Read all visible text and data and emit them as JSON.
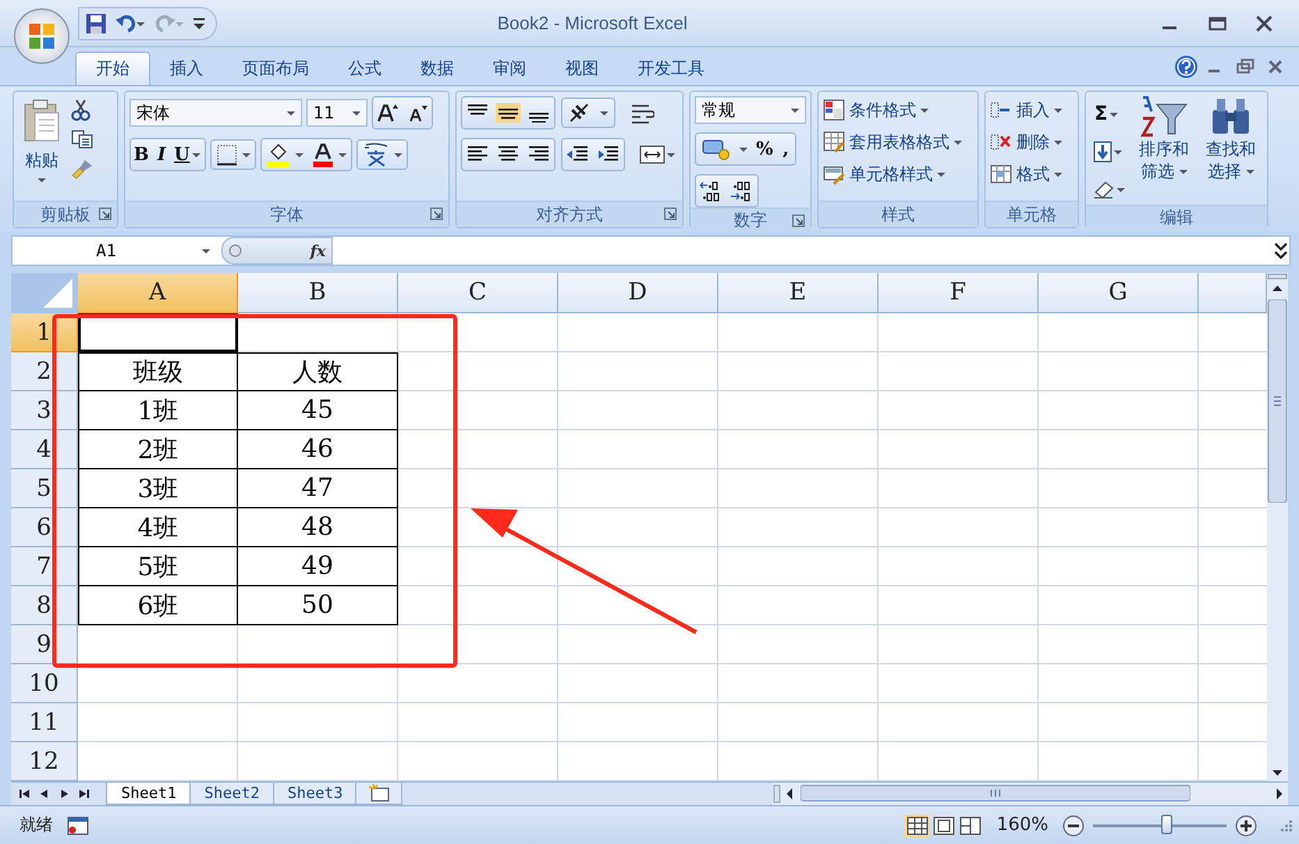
{
  "window": {
    "title": "Book2 - Microsoft Excel"
  },
  "tabs": [
    {
      "label": "开始",
      "selected": true
    },
    {
      "label": "插入",
      "selected": false
    },
    {
      "label": "页面布局",
      "selected": false
    },
    {
      "label": "公式",
      "selected": false
    },
    {
      "label": "数据",
      "selected": false
    },
    {
      "label": "审阅",
      "selected": false
    },
    {
      "label": "视图",
      "selected": false
    },
    {
      "label": "开发工具",
      "selected": false
    }
  ],
  "ribbon": {
    "clipboard": {
      "label": "剪贴板",
      "paste": "粘贴"
    },
    "font": {
      "label": "字体",
      "font_name": "宋体",
      "font_size": "11",
      "style_buttons": [
        "B",
        "I",
        "U"
      ]
    },
    "alignment": {
      "label": "对齐方式"
    },
    "number": {
      "label": "数字",
      "format": "常规",
      "buttons": [
        "%",
        ","
      ]
    },
    "styles": {
      "label": "样式",
      "items": [
        "条件格式",
        "套用表格格式",
        "单元格样式"
      ]
    },
    "cells": {
      "label": "单元格",
      "items": [
        "插入",
        "删除",
        "格式"
      ]
    },
    "editing": {
      "label": "编辑",
      "sum": "Σ",
      "sort": [
        "排序和",
        "筛选"
      ],
      "find": [
        "查找和",
        "选择"
      ]
    }
  },
  "formula_bar": {
    "name_box": "A1",
    "function_label": "fx"
  },
  "sheet": {
    "columns": [
      {
        "label": "A",
        "selected": true
      },
      {
        "label": "B",
        "selected": false
      },
      {
        "label": "C",
        "selected": false
      },
      {
        "label": "D",
        "selected": false
      },
      {
        "label": "E",
        "selected": false
      },
      {
        "label": "F",
        "selected": false
      },
      {
        "label": "G",
        "selected": false
      }
    ],
    "rows": [
      {
        "label": "1",
        "selected": true
      },
      {
        "label": "2",
        "selected": false
      },
      {
        "label": "3",
        "selected": false
      },
      {
        "label": "4",
        "selected": false
      },
      {
        "label": "5",
        "selected": false
      },
      {
        "label": "6",
        "selected": false
      },
      {
        "label": "7",
        "selected": false
      },
      {
        "label": "8",
        "selected": false
      },
      {
        "label": "9",
        "selected": false
      },
      {
        "label": "10",
        "selected": false
      },
      {
        "label": "11",
        "selected": false
      },
      {
        "label": "12",
        "selected": false
      }
    ],
    "table": [
      [
        "班级",
        "人数"
      ],
      [
        "1班",
        "45"
      ],
      [
        "2班",
        "46"
      ],
      [
        "3班",
        "47"
      ],
      [
        "4班",
        "48"
      ],
      [
        "5班",
        "49"
      ],
      [
        "6班",
        "50"
      ]
    ]
  },
  "sheet_tabs": [
    {
      "label": "Sheet1",
      "selected": true
    },
    {
      "label": "Sheet2",
      "selected": false
    },
    {
      "label": "Sheet3",
      "selected": false
    }
  ],
  "status_bar": {
    "status": "就绪",
    "zoom": "160%",
    "zoom_slider": {
      "level": 0.55
    }
  },
  "annotations": [
    {
      "kind": "rectangle"
    },
    {
      "kind": "arrow"
    }
  ]
}
